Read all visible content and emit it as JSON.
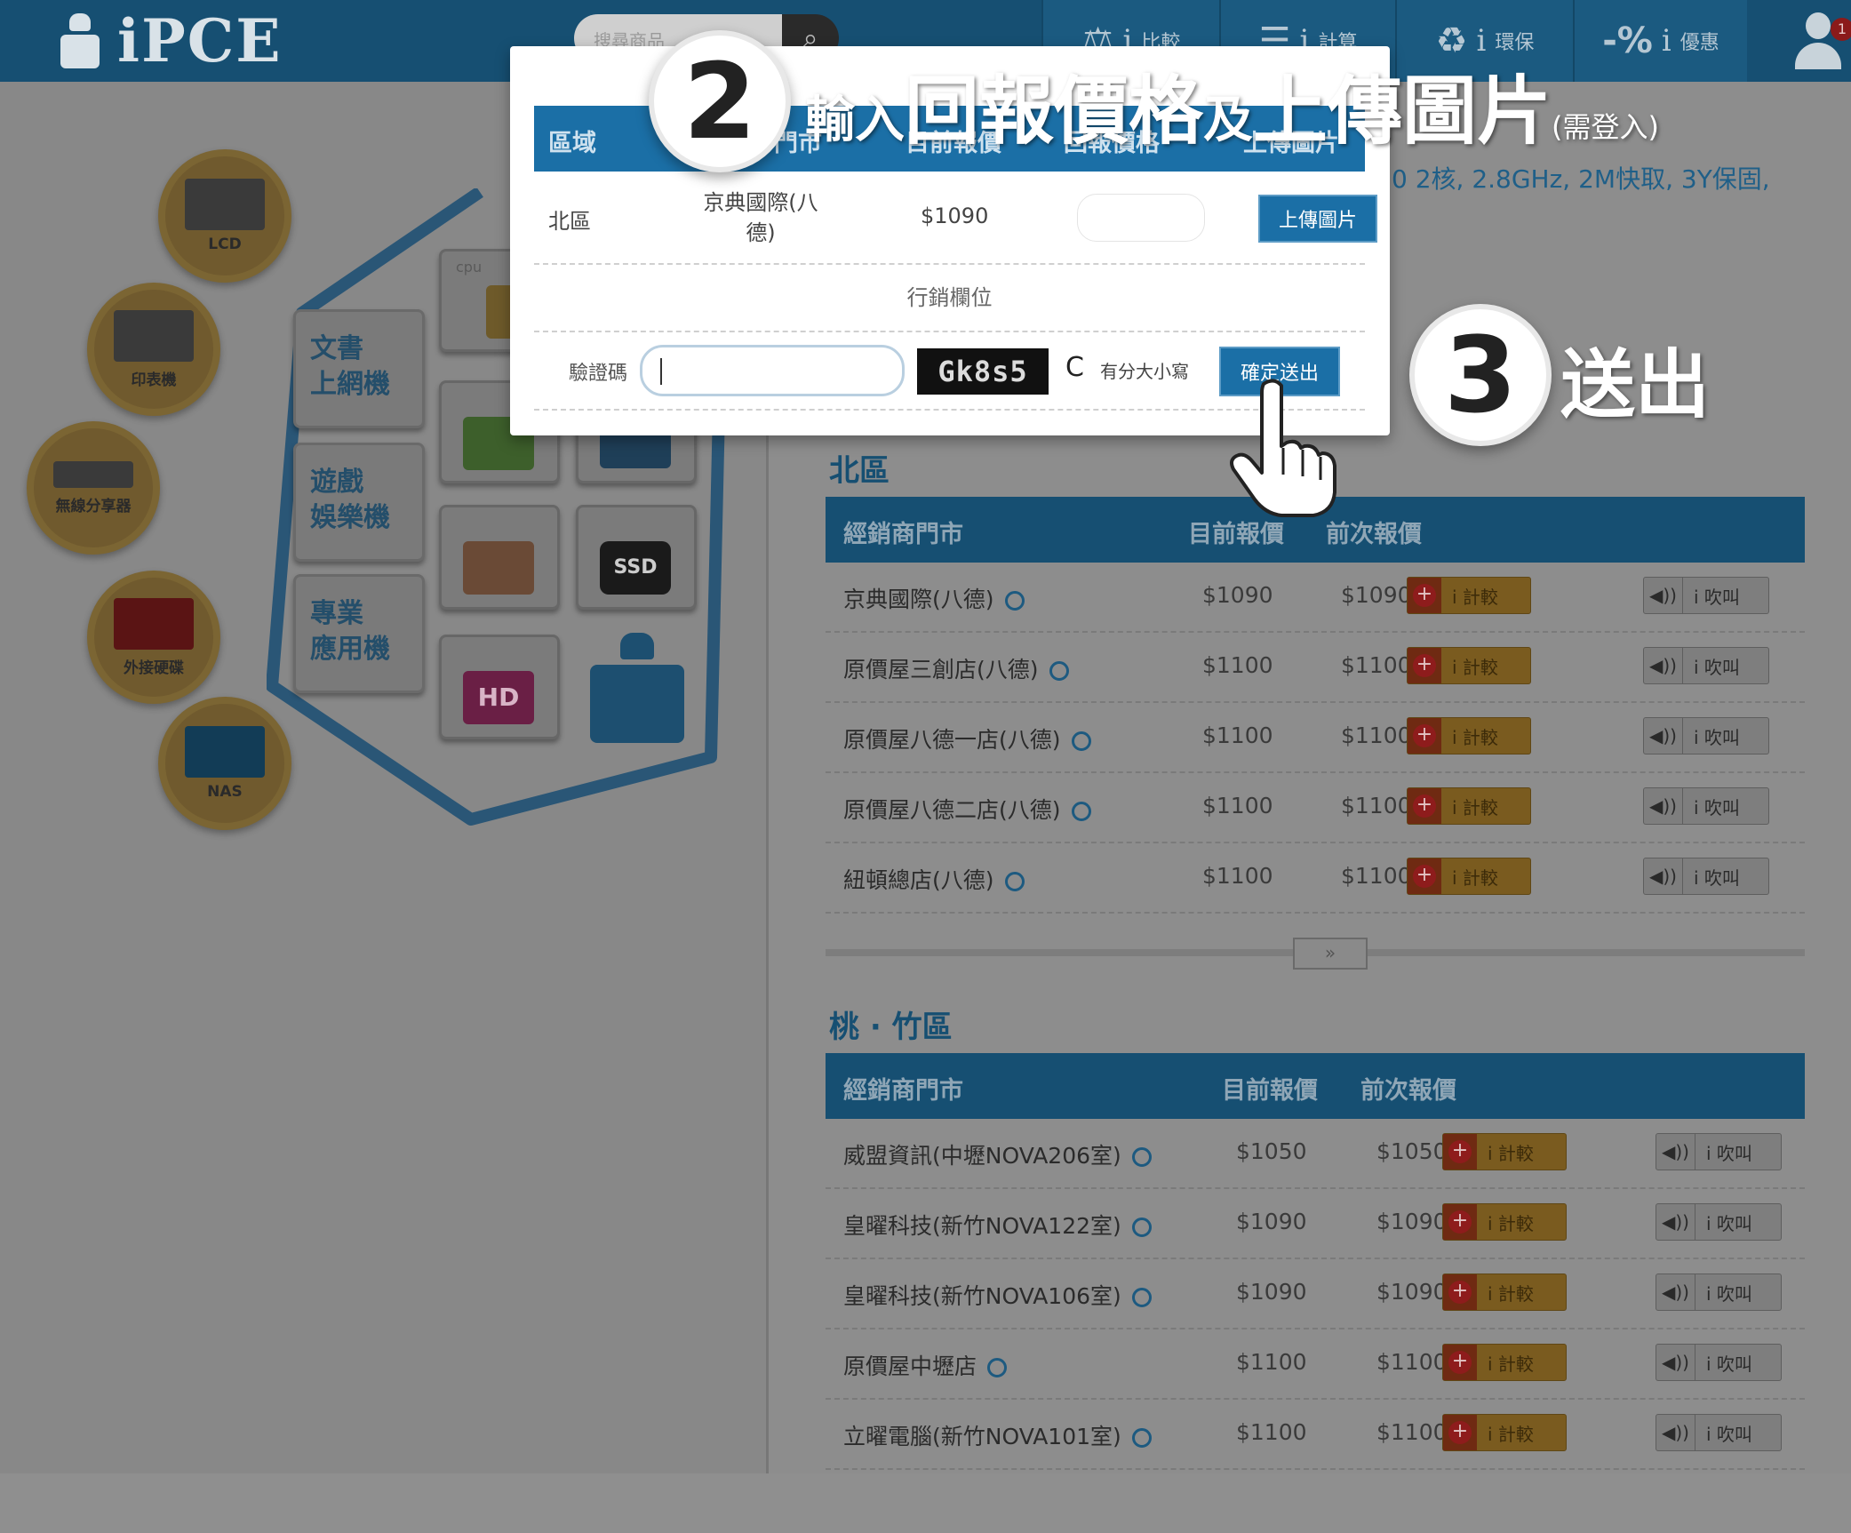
{
  "header": {
    "logo_text": "iPCE",
    "search_placeholder": "搜尋商品",
    "nav": [
      {
        "icon": "scale-icon",
        "glyph": "⚖",
        "label": "比較"
      },
      {
        "icon": "calculator-icon",
        "glyph": "☰",
        "label": "計算"
      },
      {
        "icon": "recycle-icon",
        "glyph": "♻",
        "label": "環保"
      },
      {
        "icon": "discount-icon",
        "glyph": "-%",
        "label": "優惠"
      }
    ],
    "info_glyph": "i",
    "user_badge": "1"
  },
  "left_menu": {
    "circles": [
      "LCD",
      "印表機",
      "無線分享器",
      "外接硬碟",
      "NAS"
    ],
    "tiles": [
      {
        "line1": "文書",
        "line2": "上網機"
      },
      {
        "line1": "遊戲",
        "line2": "娛樂機"
      },
      {
        "line1": "專業",
        "line2": "應用機"
      }
    ],
    "component_labels": {
      "cpu": "cpu",
      "ssd": "SSD",
      "hd": "HD"
    }
  },
  "product_info": "0 2核, 2.8GHz, 2M快取, 3Y保固,",
  "sections": [
    {
      "title": "北區",
      "headers": {
        "store": "經銷商門市",
        "current": "目前報價",
        "previous": "前次報價"
      },
      "rows": [
        {
          "store": "京典國際(八德)",
          "current": "$1090",
          "previous": "$1090"
        },
        {
          "store": "原價屋三創店(八德)",
          "current": "$1100",
          "previous": "$1100"
        },
        {
          "store": "原價屋八德一店(八德)",
          "current": "$1100",
          "previous": "$1100"
        },
        {
          "store": "原價屋八德二店(八德)",
          "current": "$1100",
          "previous": "$1100"
        },
        {
          "store": "紐頓總店(八德)",
          "current": "$1100",
          "previous": "$1100"
        }
      ]
    },
    {
      "title": "桃 · 竹區",
      "headers": {
        "store": "經銷商門市",
        "current": "目前報價",
        "previous": "前次報價"
      },
      "rows": [
        {
          "store": "威盟資訊(中壢NOVA206室)",
          "current": "$1050",
          "previous": "$1050"
        },
        {
          "store": "皇曜科技(新竹NOVA122室)",
          "current": "$1090",
          "previous": "$1090"
        },
        {
          "store": "皇曜科技(新竹NOVA106室)",
          "current": "$1090",
          "previous": "$1090"
        },
        {
          "store": "原價屋中壢店",
          "current": "$1100",
          "previous": "$1100"
        },
        {
          "store": "立曜電腦(新竹NOVA101室)",
          "current": "$1100",
          "previous": "$1100"
        }
      ]
    }
  ],
  "row_buttons": {
    "compare_label": "i 計較",
    "compare_plus": "+",
    "shout_label": "i 吹叫",
    "shout_icon": "◀))"
  },
  "more_button": "»",
  "modal": {
    "headers": {
      "region": "區域",
      "store": "門市",
      "current": "目前報價",
      "report": "回報價格",
      "upload": "上傳圖片"
    },
    "row": {
      "region": "北區",
      "store": "京典國際(八德)",
      "current": "$1090"
    },
    "upload_button": "上傳圖片",
    "marketing_label": "行銷欄位",
    "captcha_label": "驗證碼",
    "captcha_code": "Gk8s5",
    "refresh_glyph": "C",
    "case_note": "有分大小寫",
    "submit_button": "確定送出"
  },
  "tutorial": {
    "step2_number": "2",
    "step2_part1": "輸入",
    "step2_part2": "回報價格",
    "step2_part3": "及",
    "step2_part4": "上傳圖片",
    "step2_note": "(需登入)",
    "step3_number": "3",
    "step3_text": "送出"
  },
  "colors": {
    "brand_blue": "#1b6fa6",
    "dark_blue": "#164f72",
    "white": "#ffffff"
  }
}
